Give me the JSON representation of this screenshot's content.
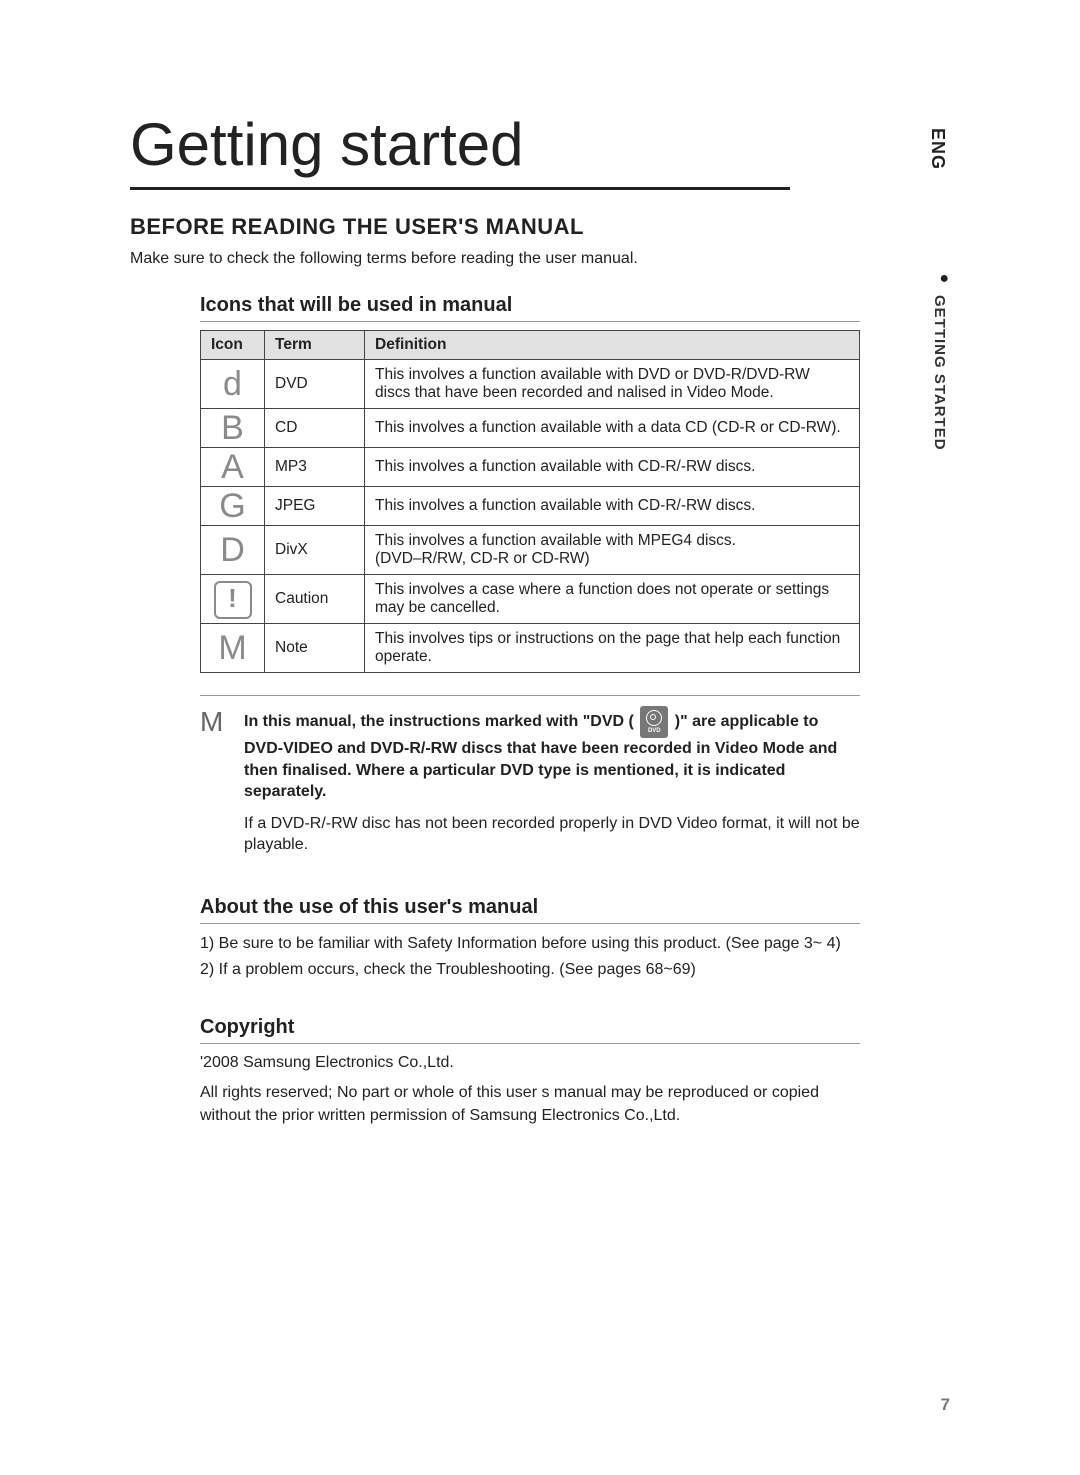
{
  "side": {
    "lang": "ENG",
    "section": "GETTING STARTED"
  },
  "h1": "Getting started",
  "h2": "BEFORE READING THE USER'S MANUAL",
  "intro": "Make sure to check the following terms before reading the user manual.",
  "icons_heading": "Icons that will be used in manual",
  "table": {
    "headers": {
      "icon": "Icon",
      "term": "Term",
      "def": "Definition"
    },
    "rows": [
      {
        "icon": "d",
        "term": "DVD",
        "def": "This involves a function available with DVD or DVD-R/DVD-RW discs that have been recorded and  nalised in Video Mode."
      },
      {
        "icon": "B",
        "term": "CD",
        "def": "This involves a function available with a data CD (CD-R or CD-RW)."
      },
      {
        "icon": "A",
        "term": "MP3",
        "def": "This involves a function available with CD-R/-RW discs."
      },
      {
        "icon": "G",
        "term": "JPEG",
        "def": "This involves a function available with CD-R/-RW discs."
      },
      {
        "icon": "D",
        "term": "DivX",
        "def": "This involves a function available with MPEG4 discs.\n(DVD–R/RW, CD-R or CD-RW)"
      },
      {
        "icon": "!",
        "term": "Caution",
        "def": "This involves a case where a function does not operate or settings may be cancelled."
      },
      {
        "icon": "M",
        "term": "Note",
        "def": "This involves tips or instructions on the page that help each function operate."
      }
    ]
  },
  "note": {
    "symbol": "M",
    "bold_pre": "In this manual, the instructions marked with \"DVD (",
    "bold_post": ")\" are applicable to DVD-VIDEO and DVD-R/-RW discs that have been recorded in Video Mode and then finalised. Where a particular DVD type is mentioned, it is indicated separately.",
    "chip_label": "DVD",
    "plain": "If a DVD-R/-RW disc has not been recorded properly in DVD Video format, it will not be playable."
  },
  "about_heading": "About the use of this user's manual",
  "about_items": [
    "1)  Be sure to be familiar with Safety Information before using this product. (See page 3~  4)",
    "2)  If a problem occurs, check the Troubleshooting. (See pages 68~69)"
  ],
  "copyright_heading": "Copyright",
  "copyright": {
    "line1": "'2008 Samsung Electronics Co.,Ltd.",
    "line2": "All rights reserved; No part or whole of this user s manual may be reproduced or copied without the prior written permission of Samsung Electronics Co.,Ltd."
  },
  "page_number": "7"
}
